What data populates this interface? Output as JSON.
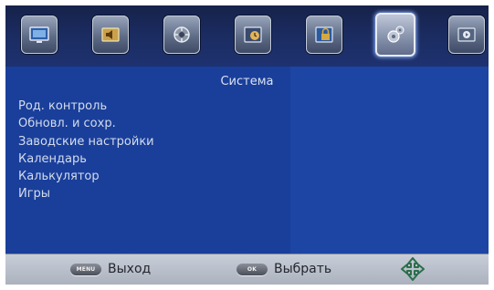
{
  "tabs": [
    {
      "icon": "picture-icon",
      "active": false
    },
    {
      "icon": "sound-icon",
      "active": false
    },
    {
      "icon": "channel-icon",
      "active": false
    },
    {
      "icon": "time-icon",
      "active": false
    },
    {
      "icon": "lock-icon",
      "active": false
    },
    {
      "icon": "system-icon",
      "active": true
    },
    {
      "icon": "media-icon",
      "active": false
    }
  ],
  "section": {
    "title": "Система"
  },
  "menu": {
    "items": [
      {
        "label": "Род. контроль"
      },
      {
        "label": "Обновл. и сохр."
      },
      {
        "label": "Заводские настройки"
      },
      {
        "label": "Календарь"
      },
      {
        "label": "Калькулятор"
      },
      {
        "label": "Игры"
      }
    ]
  },
  "footer": {
    "menu_key": "MENU",
    "menu_label": "Выход",
    "ok_key": "OK",
    "ok_label": "Выбрать",
    "nav_icon": "dpad-icon"
  },
  "colors": {
    "panel": "#1a3f9a",
    "topbar": "#1b2c62",
    "footer": "#bcc2cc"
  }
}
